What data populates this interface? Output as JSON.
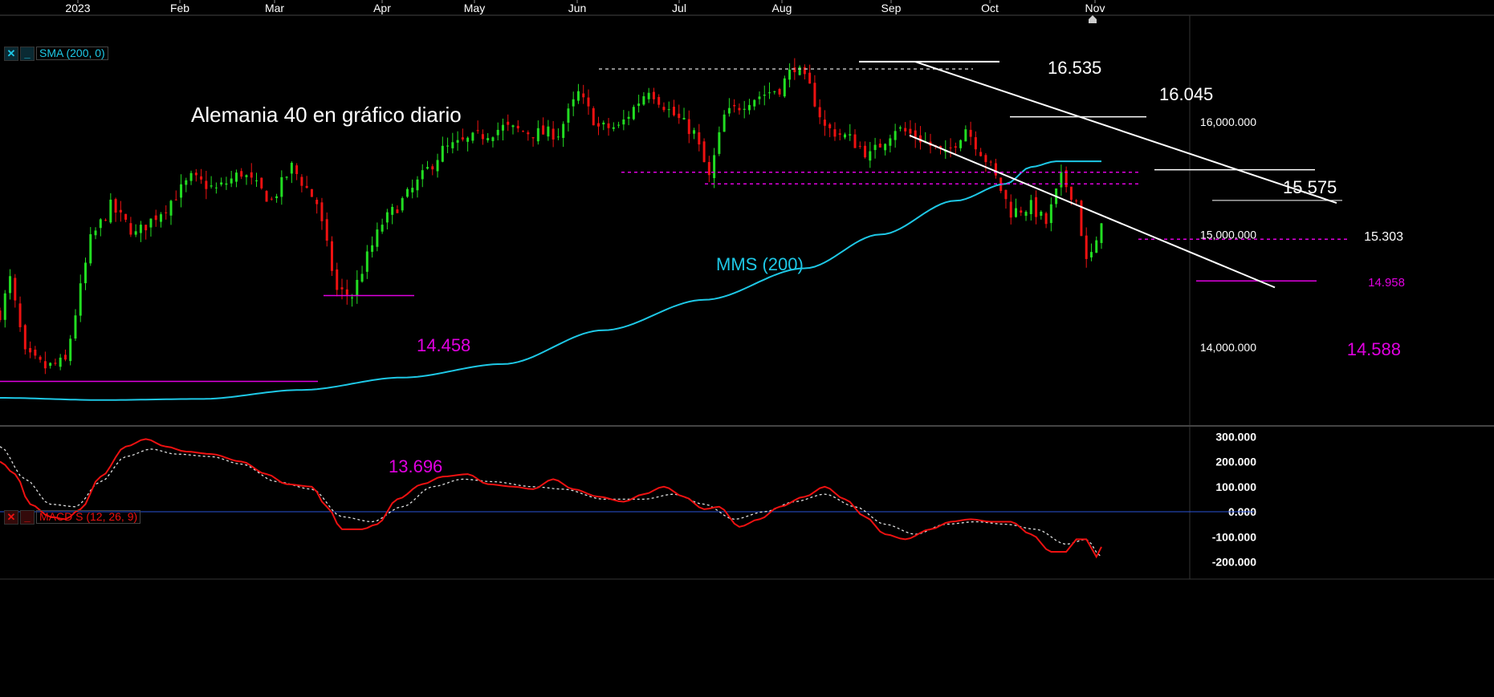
{
  "colors": {
    "background": "#000000",
    "axis_text": "#ffffff",
    "bull_candle": "#22dd22",
    "bear_candle": "#ee1111",
    "sma": "#1ec8e6",
    "macd": "#ee1111",
    "macd_signal": "#dddddd",
    "zero_line": "#2a52d6",
    "magenta": "#e000e0",
    "annotation_white": "#ffffff"
  },
  "time_axis": {
    "labels": [
      "2023",
      "Feb",
      "Mar",
      "Apr",
      "May",
      "Jun",
      "Jul",
      "Aug",
      "Sep",
      "Oct",
      "Nov"
    ]
  },
  "price_axis": {
    "labels": [
      "16,000.000",
      "15,000.000",
      "14,000.000"
    ]
  },
  "macd_axis": {
    "labels": [
      "300.000",
      "200.000",
      "100.000",
      "0.000",
      "-100.000",
      "-200.000"
    ]
  },
  "indicator_tags": {
    "sma": {
      "close_icon": "close-icon",
      "collapse_icon": "minimize-icon",
      "label": "SMA (200, 0)"
    },
    "macd": {
      "close_icon": "close-icon",
      "collapse_icon": "minimize-icon",
      "label": "MACD S (12, 26, 9)"
    }
  },
  "annotations": {
    "title": "Alemania 40 en gráfico diario",
    "sma_label": "MMS (200)",
    "level_16535": "16.535",
    "level_16045": "16.045",
    "level_15575": "15.575",
    "level_15303": "15.303",
    "level_14958": "14.958",
    "level_14588": "14.588",
    "level_14458": "14.458",
    "level_13696": "13.696"
  },
  "chart_data": [
    {
      "type": "candlestick",
      "title": "Alemania 40 en gráfico diario",
      "x_range": [
        "2023-01",
        "2023-11"
      ],
      "ylim": [
        13500,
        16800
      ],
      "y_ticks": [
        14000,
        15000,
        16000
      ],
      "grid": false,
      "series": [
        {
          "name": "SMA (200, 0)",
          "type": "line",
          "x": [
            "2023-01",
            "2023-02",
            "2023-03",
            "2023-04",
            "2023-05",
            "2023-06",
            "2023-07",
            "2023-08",
            "2023-09",
            "2023-10",
            "2023-11"
          ],
          "values": [
            13550,
            13620,
            13730,
            13820,
            14150,
            14480,
            14800,
            15180,
            15420,
            15600,
            15640
          ]
        }
      ],
      "monthly_candles": [
        {
          "month": "2023-01",
          "open": 13930,
          "high": 15260,
          "low": 13696,
          "close": 15150
        },
        {
          "month": "2023-02",
          "open": 15150,
          "high": 15650,
          "low": 15050,
          "close": 15360
        },
        {
          "month": "2023-03",
          "open": 15360,
          "high": 15720,
          "low": 14458,
          "close": 15620
        },
        {
          "month": "2023-04",
          "open": 15620,
          "high": 15950,
          "low": 15480,
          "close": 15920
        },
        {
          "month": "2023-05",
          "open": 15920,
          "high": 16330,
          "low": 15640,
          "close": 15690
        },
        {
          "month": "2023-06",
          "open": 15690,
          "high": 16430,
          "low": 15700,
          "close": 16150
        },
        {
          "month": "2023-07",
          "open": 16150,
          "high": 16535,
          "low": 15460,
          "close": 16450
        },
        {
          "month": "2023-08",
          "open": 16450,
          "high": 16535,
          "low": 15470,
          "close": 15880
        },
        {
          "month": "2023-09",
          "open": 15880,
          "high": 16045,
          "low": 15140,
          "close": 15390
        },
        {
          "month": "2023-10",
          "open": 15390,
          "high": 15575,
          "low": 14630,
          "close": 14810
        },
        {
          "month": "2023-11",
          "open": 14810,
          "high": 15150,
          "low": 14780,
          "close": 15100
        }
      ],
      "horizontal_levels": [
        {
          "label": "16.535",
          "value": 16535,
          "style": "solid-white"
        },
        {
          "label": "16.045",
          "value": 16045,
          "style": "solid-white"
        },
        {
          "label": "15.575",
          "value": 15575,
          "style": "solid-white"
        },
        {
          "label": "15.303",
          "value": 15303,
          "style": "solid-white"
        },
        {
          "label": "14.958",
          "value": 14958,
          "style": "dashed-magenta"
        },
        {
          "label": "14.588",
          "value": 14588,
          "style": "solid-magenta"
        },
        {
          "label": "14.458",
          "value": 14458,
          "style": "solid-magenta"
        },
        {
          "label": "13.696",
          "value": 13696,
          "style": "solid-magenta"
        }
      ],
      "annotations": [
        "MMS (200)"
      ]
    },
    {
      "type": "line",
      "title": "MACD S (12, 26, 9)",
      "x_range": [
        "2023-01",
        "2023-11"
      ],
      "ylim": [
        -230,
        320
      ],
      "y_ticks": [
        300,
        200,
        100,
        0,
        -100,
        -200
      ],
      "series": [
        {
          "name": "MACD",
          "x": [
            "2023-01",
            "2023-02",
            "2023-03",
            "2023-04",
            "2023-05",
            "2023-06",
            "2023-07",
            "2023-08",
            "2023-09",
            "2023-10",
            "2023-11"
          ],
          "values": [
            190,
            225,
            110,
            -70,
            140,
            80,
            -40,
            100,
            -90,
            -110,
            -140
          ]
        },
        {
          "name": "Signal",
          "x": [
            "2023-01",
            "2023-02",
            "2023-03",
            "2023-04",
            "2023-05",
            "2023-06",
            "2023-07",
            "2023-08",
            "2023-09",
            "2023-10",
            "2023-11"
          ],
          "values": [
            240,
            230,
            130,
            -20,
            120,
            100,
            0,
            60,
            -60,
            -80,
            -190
          ]
        }
      ]
    }
  ]
}
